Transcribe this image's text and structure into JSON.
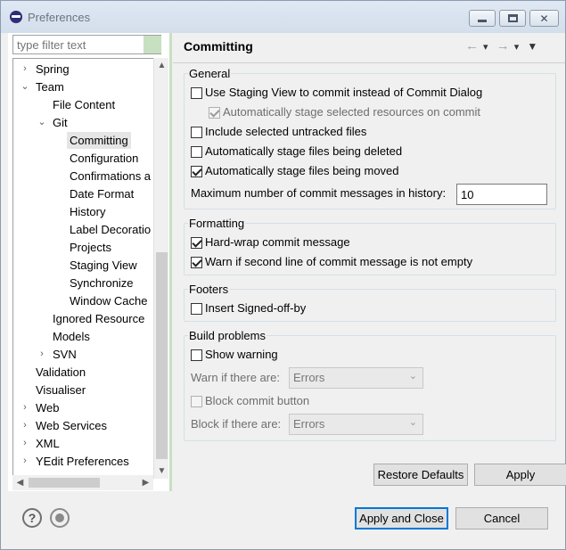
{
  "window": {
    "title": "Preferences"
  },
  "filter": {
    "placeholder": "type filter text"
  },
  "tree": [
    {
      "label": "Spring",
      "toggle": ">"
    },
    {
      "label": "Team",
      "toggle": "v"
    },
    {
      "label": "File Content",
      "toggle": ""
    },
    {
      "label": "Git",
      "toggle": "v"
    },
    {
      "label": "Committing",
      "toggle": ""
    },
    {
      "label": "Configuration",
      "toggle": ""
    },
    {
      "label": "Confirmations a",
      "toggle": ""
    },
    {
      "label": "Date Format",
      "toggle": ""
    },
    {
      "label": "History",
      "toggle": ""
    },
    {
      "label": "Label Decoratio",
      "toggle": ""
    },
    {
      "label": "Projects",
      "toggle": ""
    },
    {
      "label": "Staging View",
      "toggle": ""
    },
    {
      "label": "Synchronize",
      "toggle": ""
    },
    {
      "label": "Window Cache",
      "toggle": ""
    },
    {
      "label": "Ignored Resource",
      "toggle": ""
    },
    {
      "label": "Models",
      "toggle": ""
    },
    {
      "label": "SVN",
      "toggle": ">"
    },
    {
      "label": "Validation",
      "toggle": ""
    },
    {
      "label": "Visualiser",
      "toggle": ""
    },
    {
      "label": "Web",
      "toggle": ">"
    },
    {
      "label": "Web Services",
      "toggle": ">"
    },
    {
      "label": "XML",
      "toggle": ">"
    },
    {
      "label": "YEdit Preferences",
      "toggle": ">"
    }
  ],
  "page": {
    "title": "Committing",
    "general": {
      "legend": "General",
      "use_staging_view": {
        "label": "Use Staging View to commit instead of Commit Dialog",
        "checked": false
      },
      "auto_stage_selected": {
        "label": "Automatically stage selected resources on commit",
        "checked": true,
        "disabled": true
      },
      "include_untracked": {
        "label": "Include selected untracked files",
        "checked": false
      },
      "auto_stage_deleted": {
        "label": "Automatically stage files being deleted",
        "checked": false
      },
      "auto_stage_moved": {
        "label": "Automatically stage files being moved",
        "checked": true
      },
      "max_messages_label": "Maximum number of commit messages in history:",
      "max_messages_value": "10"
    },
    "formatting": {
      "legend": "Formatting",
      "hard_wrap": {
        "label": "Hard-wrap commit message",
        "checked": true
      },
      "warn_second_line": {
        "label": "Warn if second line of commit message is not empty",
        "checked": true
      }
    },
    "footers": {
      "legend": "Footers",
      "signed_off": {
        "label": "Insert Signed-off-by",
        "checked": false
      }
    },
    "build_problems": {
      "legend": "Build problems",
      "show_warning": {
        "label": "Show warning",
        "checked": false
      },
      "warn_label": "Warn if there are:",
      "warn_value": "Errors",
      "block_commit": {
        "label": "Block commit button",
        "checked": false,
        "disabled": true
      },
      "block_label": "Block if there are:",
      "block_value": "Errors"
    },
    "restore_defaults": "Restore Defaults",
    "apply": "Apply"
  },
  "footer": {
    "apply_and_close": "Apply and Close",
    "cancel": "Cancel"
  },
  "icons": {
    "nav_back": "←",
    "nav_forward": "→",
    "menu": "▼"
  },
  "colors": {
    "accent_border": "#0078d7",
    "tree_selection": "#e5e5e5",
    "left_panel_accent": "#c7e0c2"
  }
}
